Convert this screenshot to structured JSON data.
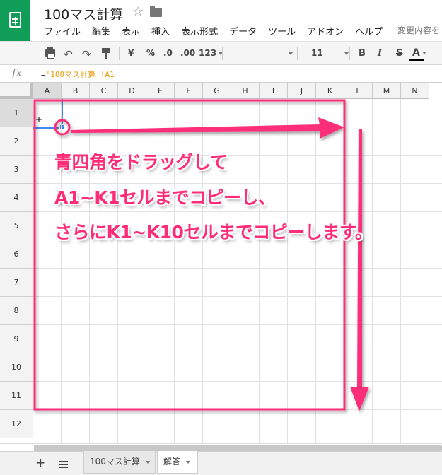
{
  "app": {
    "title": "100マス計算",
    "save_status": "変更内容を"
  },
  "menu": [
    "ファイル",
    "編集",
    "表示",
    "挿入",
    "表示形式",
    "データ",
    "ツール",
    "アドオン",
    "ヘルプ"
  ],
  "toolbar": {
    "currency": "¥",
    "percent": "%",
    "decimal_decrease": ".0",
    "decimal_increase": ".00",
    "number_format": "123",
    "font_size": "11",
    "bold": "B",
    "italic": "I",
    "strikethrough": "S",
    "text_color": "A"
  },
  "formula_bar": {
    "fx": "fx",
    "prefix": "=",
    "reference": "'100マス計算'!A1"
  },
  "grid": {
    "columns": [
      "A",
      "B",
      "C",
      "D",
      "E",
      "F",
      "G",
      "H",
      "I",
      "J",
      "K",
      "L",
      "M",
      "N"
    ],
    "rows": [
      "1",
      "2",
      "3",
      "4",
      "5",
      "6",
      "7",
      "8",
      "9",
      "10",
      "11",
      "12"
    ],
    "active_cell": "A1",
    "cursor": "+"
  },
  "sheet_tabs": [
    {
      "label": "100マス計算",
      "active": false
    },
    {
      "label": "解答",
      "active": true
    }
  ],
  "annotation": {
    "lines": [
      "青四角をドラッグして",
      "A1~K1セルまでコピーし、",
      "さらにK1~K10セルまでコピーします。"
    ],
    "color": "#ff2d78"
  },
  "colors": {
    "brand": "#0f9d58",
    "selection": "#4285f4",
    "formula_ref": "#e69a00"
  }
}
